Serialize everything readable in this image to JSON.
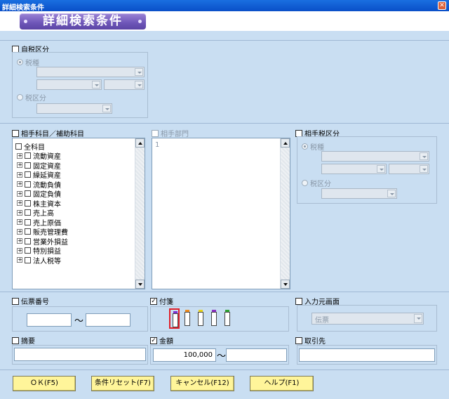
{
  "window": {
    "title": "詳細検索条件"
  },
  "banner": {
    "title": "詳細検索条件"
  },
  "tax_section": {
    "checkbox_label": "自税区分",
    "radio_tax_type": "税種",
    "radio_tax_class": "税区分"
  },
  "account_section": {
    "checkbox_label": "相手科目／補助科目",
    "root_label": "全科目",
    "items": [
      "流動資産",
      "固定資産",
      "繰延資産",
      "流動負債",
      "固定負債",
      "株主資本",
      "売上高",
      "売上原価",
      "販売管理費",
      "営業外損益",
      "特別損益",
      "法人税等"
    ]
  },
  "dept_section": {
    "checkbox_label": "相手部門",
    "list_first_item": "1"
  },
  "partner_tax_section": {
    "checkbox_label": "相手税区分",
    "radio_tax_type": "税種",
    "radio_tax_class": "税区分"
  },
  "voucher_section": {
    "checkbox_label": "伝票番号",
    "from_value": "",
    "to_value": "",
    "tilde": "～"
  },
  "fusen_section": {
    "checkbox_label": "付箋",
    "checked": true,
    "colors": [
      "#7a2fd0",
      "#f08a1a",
      "#e8d21a",
      "#8a2fc0",
      "#2ea22e"
    ]
  },
  "input_screen_section": {
    "checkbox_label": "入力元画面",
    "selected_value": "伝票"
  },
  "summary_section": {
    "checkbox_label": "摘要",
    "value": ""
  },
  "amount_section": {
    "checkbox_label": "金額",
    "checked": true,
    "from_value": "100,000",
    "to_value": "",
    "tilde": "～"
  },
  "client_section": {
    "checkbox_label": "取引先",
    "value": ""
  },
  "buttons": {
    "ok": "ＯＫ(F5)",
    "reset": "条件リセット(F7)",
    "cancel": "キャンセル(F12)",
    "help": "ヘルプ(F1)"
  }
}
